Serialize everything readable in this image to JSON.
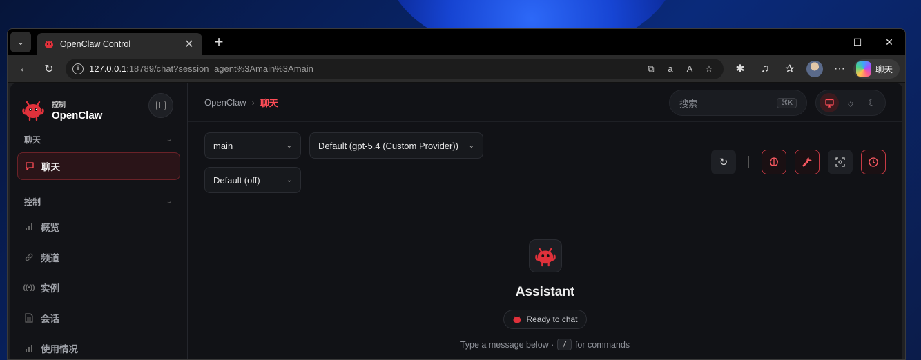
{
  "browser": {
    "tab_title": "OpenClaw Control",
    "url_host": "127.0.0.1",
    "url_rest": ":18789/chat?session=agent%3Amain%3Amain",
    "copilot_label": "聊天"
  },
  "sidebar": {
    "brand_sub": "控制",
    "brand_name": "OpenClaw",
    "section_chat": "聊天",
    "chat_item": "聊天",
    "section_control": "控制",
    "items": [
      {
        "label": "概览",
        "icon": "bar-chart-icon"
      },
      {
        "label": "频道",
        "icon": "link-icon"
      },
      {
        "label": "实例",
        "icon": "broadcast-icon"
      },
      {
        "label": "会话",
        "icon": "document-icon"
      },
      {
        "label": "使用情况",
        "icon": "bar-chart-icon"
      }
    ]
  },
  "topbar": {
    "crumb_root": "OpenClaw",
    "crumb_current": "聊天",
    "search_placeholder": "搜索",
    "search_shortcut": "⌘K"
  },
  "selectors": {
    "agent": "main",
    "model": "Default (gpt-5.4 (Custom Provider))",
    "thinking": "Default (off)"
  },
  "welcome": {
    "title": "Assistant",
    "status": "Ready to chat",
    "hint_before": "Type a message below ·",
    "hint_key": "/",
    "hint_after": "for commands"
  },
  "colors": {
    "accent": "#ff4d57",
    "background": "#111216"
  }
}
